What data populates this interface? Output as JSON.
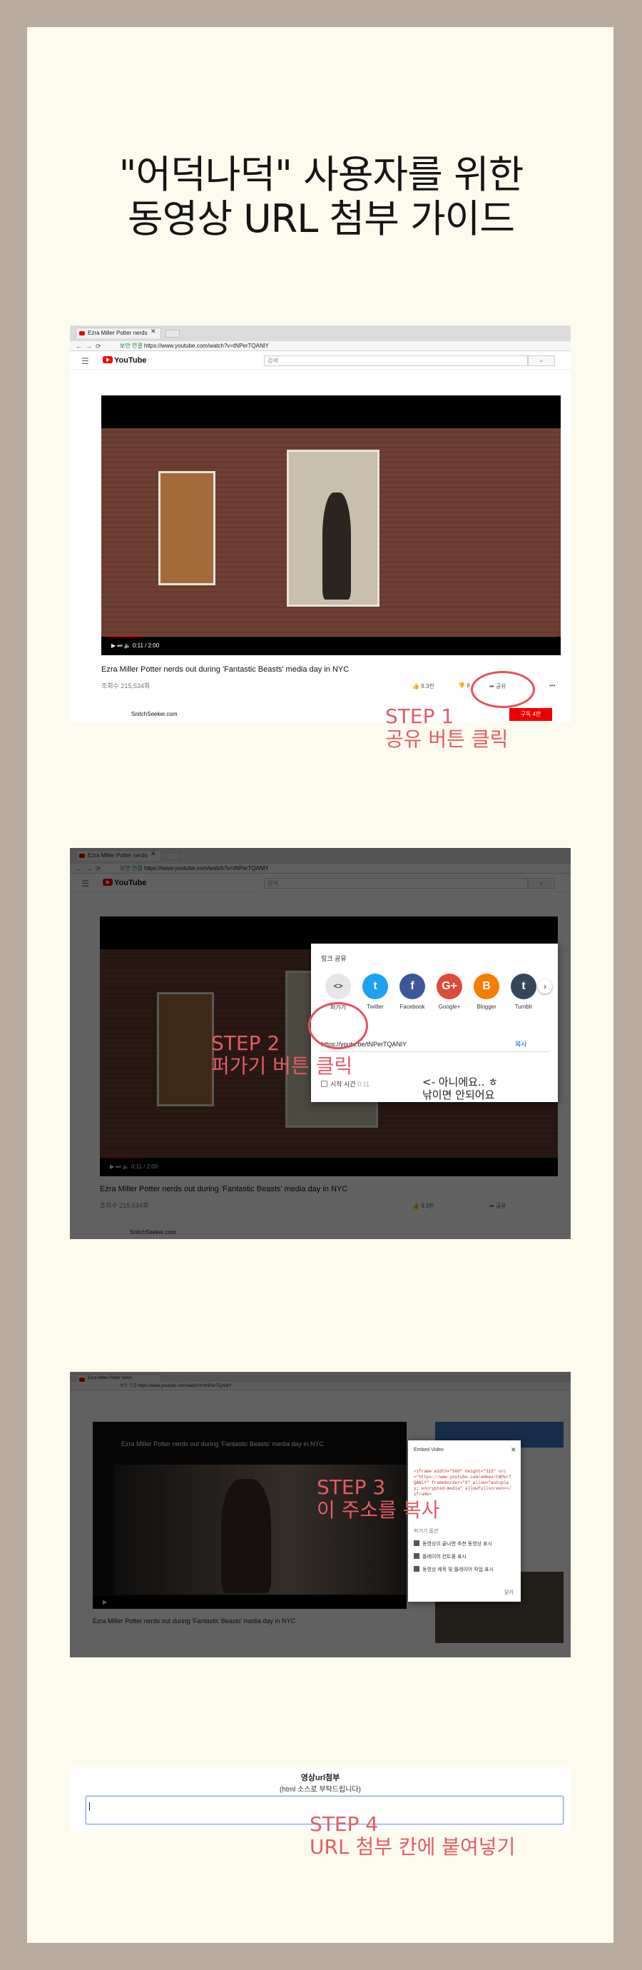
{
  "title": {
    "line1": "\"어덕나덕\" 사용자를 위한",
    "line2": "동영상 URL 첨부 가이드"
  },
  "browser": {
    "tab_title": "Ezra Miller Potter nerds",
    "secure_label": "보안 연결",
    "url": "https://www.youtube.com/watch?v=tNPerTQANlY",
    "search_placeholder": "검색"
  },
  "video": {
    "title": "Ezra Miller Potter nerds out during 'Fantastic Beasts' media day in NYC",
    "views": "조회수 215,534회",
    "time": "0:11 / 2:00",
    "likes": "9.3천",
    "dislikes": "8",
    "share": "공유",
    "channel": "SnitchSeeker.com",
    "subscribe": "구독 4만"
  },
  "steps": [
    {
      "label": "STEP 1",
      "desc": "공유 버튼 클릭"
    },
    {
      "label": "STEP 2",
      "desc": "퍼가기 버튼 클릭"
    },
    {
      "label": "STEP 3",
      "desc": "이 주소를 복사"
    },
    {
      "label": "STEP 4",
      "desc": "URL 첨부 칸에 붙여넣기"
    }
  ],
  "share_dialog": {
    "heading": "링크 공유",
    "items": [
      {
        "label": "퍼가기",
        "glyph": "<>",
        "color": "#e6e6e6"
      },
      {
        "label": "Twitter",
        "glyph": "t",
        "color": "#1da1f2"
      },
      {
        "label": "Facebook",
        "glyph": "f",
        "color": "#3b5998"
      },
      {
        "label": "Google+",
        "glyph": "G+",
        "color": "#dd4b39"
      },
      {
        "label": "Blogger",
        "glyph": "B",
        "color": "#f57d00"
      },
      {
        "label": "Tumblr",
        "glyph": "t",
        "color": "#35465c"
      }
    ],
    "link": "https://youtu.be/tNPerTQANlY",
    "copy": "복사",
    "start_at": "시작 시간",
    "start_time": "0:11",
    "note_line1": "<- 아니에요.. ㅎ",
    "note_line2": "낚이면 안되어요"
  },
  "embed_dialog": {
    "heading": "Embed Video",
    "code": "<iframe width=\"560\" height=\"315\" src=\"https://www.youtube.com/embed/tNPerTQANlY\" frameborder=\"0\" allow=\"autoplay; encrypted-media\" allowfullscreen></iframe>",
    "options_heading": "퍼가기 옵션",
    "options": [
      "동영상이 끝나면 추천 동영상 표시",
      "플레이어 컨트롤 표시",
      "동영상 제목 및 플레이어 작업 표시"
    ],
    "close": "닫기"
  },
  "form": {
    "title": "영상url첨부",
    "subtitle": "(html 소스로 부탁드립니다)"
  }
}
